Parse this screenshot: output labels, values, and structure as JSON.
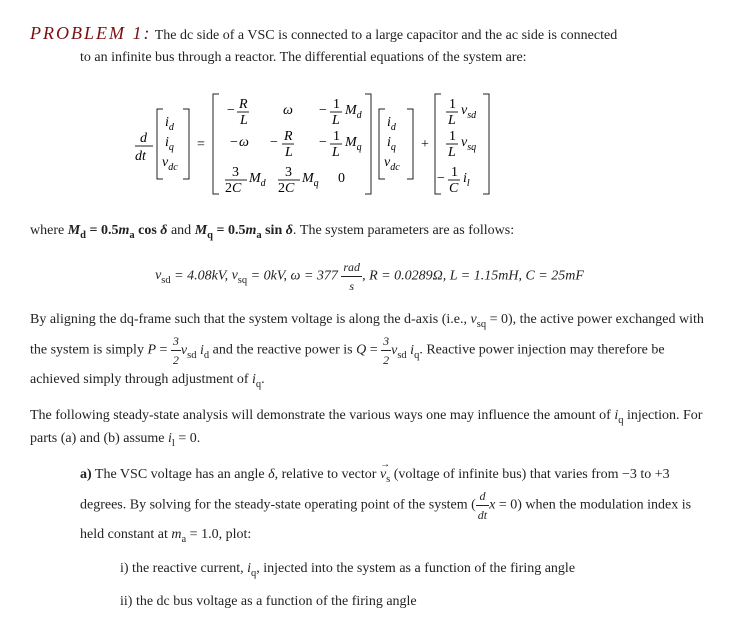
{
  "problem": {
    "label": "PROBLEM 1:",
    "intro_line1": "The dc side of a VSC is connected to a large capacitor and the ac side is connected",
    "intro_line2": "to an infinite bus through a reactor. The differential equations of the system are:"
  },
  "matrix": {
    "state_vars": [
      "i_d",
      "i_q",
      "v_dc"
    ],
    "A": [
      [
        "-R/L",
        "ω",
        "-(1/L) M_d"
      ],
      [
        "-ω",
        "-R/L",
        "-(1/L) M_q"
      ],
      [
        "(3/2C) M_d",
        "(3/2C) M_q",
        "0"
      ]
    ],
    "u": [
      "(1/L) v_sd",
      "(1/L) v_sq",
      "-(1/C) i_l"
    ]
  },
  "relations": {
    "text_before": "where ",
    "Md": "M_d = 0.5 m_a cos δ",
    "and": " and ",
    "Mq": "M_q = 0.5 m_a sin δ",
    "text_after": ". The system parameters are as follows:"
  },
  "params": {
    "vsd": "v_sd = 4.08kV",
    "vsq": "v_sq = 0kV",
    "omega": "ω = 377 rad/s",
    "R": "R = 0.0289Ω",
    "L": "L = 1.15mH",
    "C": "C = 25mF"
  },
  "chart_data": {
    "type": "table",
    "title": "VSC system parameters",
    "rows": [
      {
        "symbol": "v_sd",
        "value": 4.08,
        "unit": "kV"
      },
      {
        "symbol": "v_sq",
        "value": 0,
        "unit": "kV"
      },
      {
        "symbol": "ω",
        "value": 377,
        "unit": "rad/s"
      },
      {
        "symbol": "R",
        "value": 0.0289,
        "unit": "Ω"
      },
      {
        "symbol": "L",
        "value": 1.15,
        "unit": "mH"
      },
      {
        "symbol": "C",
        "value": 25,
        "unit": "mF"
      },
      {
        "symbol": "m_a",
        "value": 1.0,
        "unit": ""
      },
      {
        "symbol": "δ range",
        "value": "−3 to +3",
        "unit": "degrees"
      }
    ]
  },
  "body": {
    "p1a": "By aligning the dq-frame such that the system voltage is along the d-axis (i.e., ",
    "p1b": "), the active power exchanged with the system is simply ",
    "p1c": " and the reactive power is ",
    "p1d": ". Reactive power injection may therefore be achieved simply through adjustment of ",
    "p1e": ".",
    "p2a": "The following steady-state analysis will demonstrate the various ways one may influence the amount of ",
    "p2b": " injection. For parts (a) and (b) assume ",
    "p2c": "."
  },
  "partA": {
    "label": "a)",
    "t1": " The VSC voltage has an angle ",
    "t2": ", relative to vector ",
    "t3": " (voltage of infinite bus) that varies from −3 to +3 degrees. By solving for the steady-state operating point of the system (",
    "t4": ") when the modulation index is held constant at ",
    "t5": ", plot:",
    "i": "i) the reactive current, ",
    "i2": ", injected into the system as a function of the firing angle",
    "ii": "ii) the dc bus voltage as a function of the firing angle"
  },
  "math": {
    "vsq0": "v_sq = 0",
    "P": "P = (3/2) v_sd i_d",
    "Q": "Q = (3/2) v_sd i_q",
    "iq": "i_q",
    "il0": "i_l = 0",
    "delta": "δ",
    "vs": "v_s",
    "dxdt0": "d/dt x = 0",
    "ma1": "m_a = 1.0"
  }
}
